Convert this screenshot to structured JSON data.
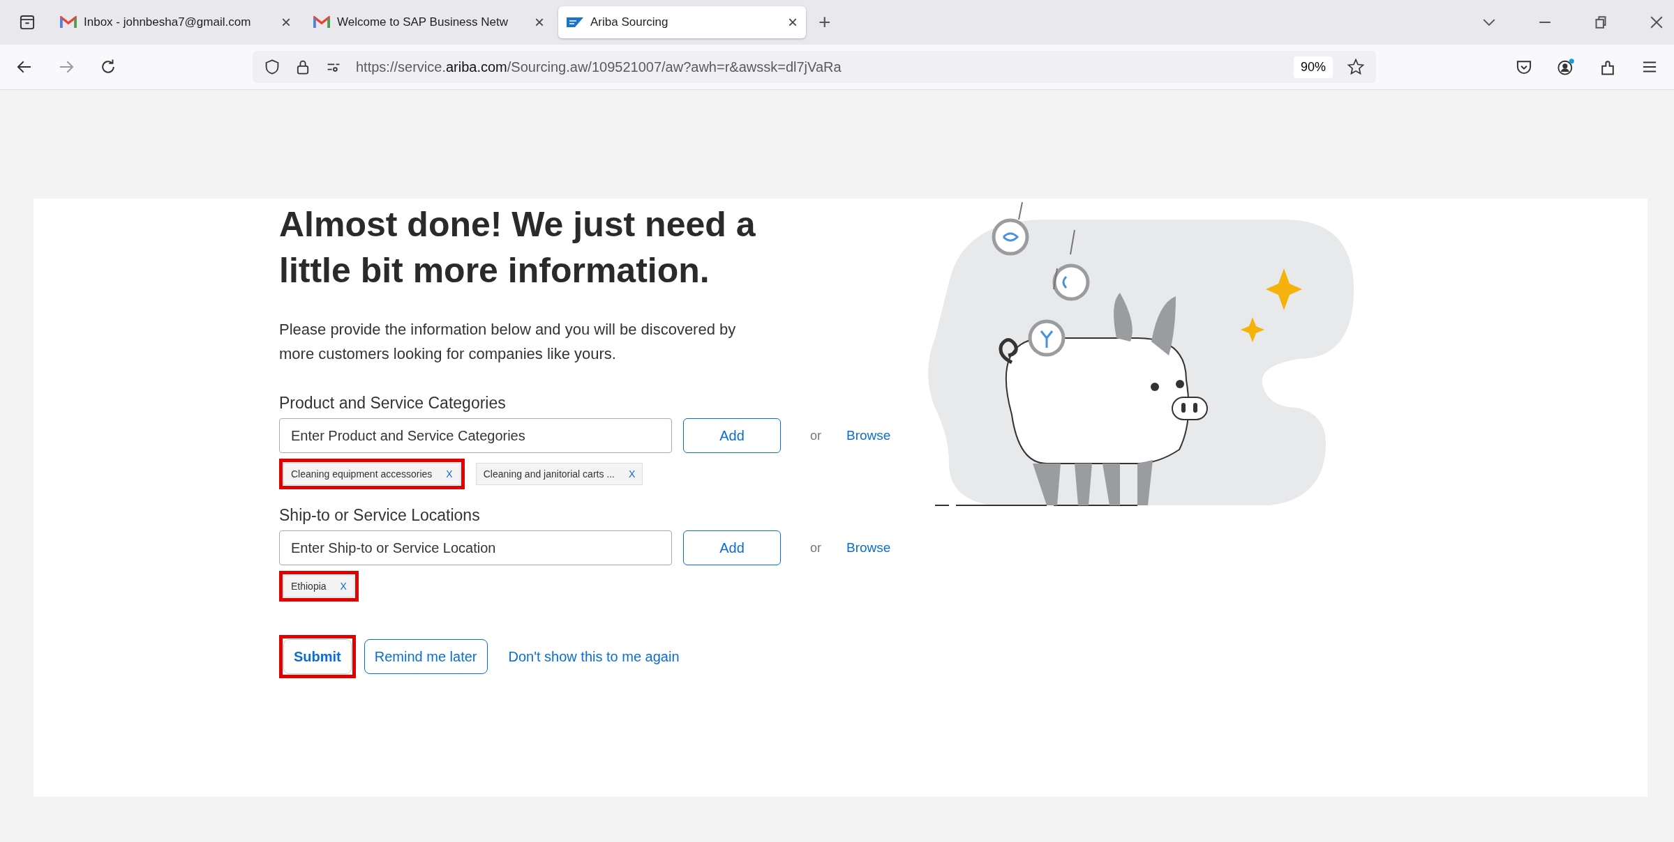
{
  "tabs": [
    {
      "label": "Inbox - johnbesha7@gmail.com",
      "kind": "mail",
      "selected": false,
      "close": "×"
    },
    {
      "label": "Welcome to SAP Business Netw",
      "kind": "mail",
      "selected": false,
      "close": "×"
    },
    {
      "label": "Ariba Sourcing",
      "kind": "sap",
      "selected": true,
      "close": "×"
    }
  ],
  "new_tab": "+",
  "address_bar": {
    "prefix": "https://service.",
    "domain": "ariba.com",
    "path": "/Sourcing.aw/109521007/aw?awh=r&awssk=dl7jVaRa",
    "zoom": "90%"
  },
  "page": {
    "heading": "Almost done! We just need a little bit more information.",
    "intro": "Please provide the information below and you will be discovered by more customers looking for companies like yours.",
    "sections": [
      {
        "label": "Product and Service Categories",
        "placeholder": "Enter Product and Service Categories",
        "add": "Add",
        "or": "or",
        "browse": "Browse",
        "chips": [
          {
            "text": "Cleaning equipment accessories",
            "remove": "X",
            "highlighted": true
          },
          {
            "text": "Cleaning and janitorial carts ...",
            "remove": "X",
            "highlighted": false
          }
        ]
      },
      {
        "label": "Ship-to or Service Locations",
        "placeholder": "Enter Ship-to or Service Location",
        "add": "Add",
        "or": "or",
        "browse": "Browse",
        "chips": [
          {
            "text": "Ethiopia",
            "remove": "X",
            "highlighted": true
          }
        ]
      }
    ],
    "actions": [
      {
        "label": "Submit",
        "kind": "primary",
        "highlighted": true
      },
      {
        "label": "Remind me later",
        "kind": "outline",
        "highlighted": false
      },
      {
        "label": "Don't show this to me again",
        "kind": "link",
        "highlighted": false
      }
    ]
  }
}
